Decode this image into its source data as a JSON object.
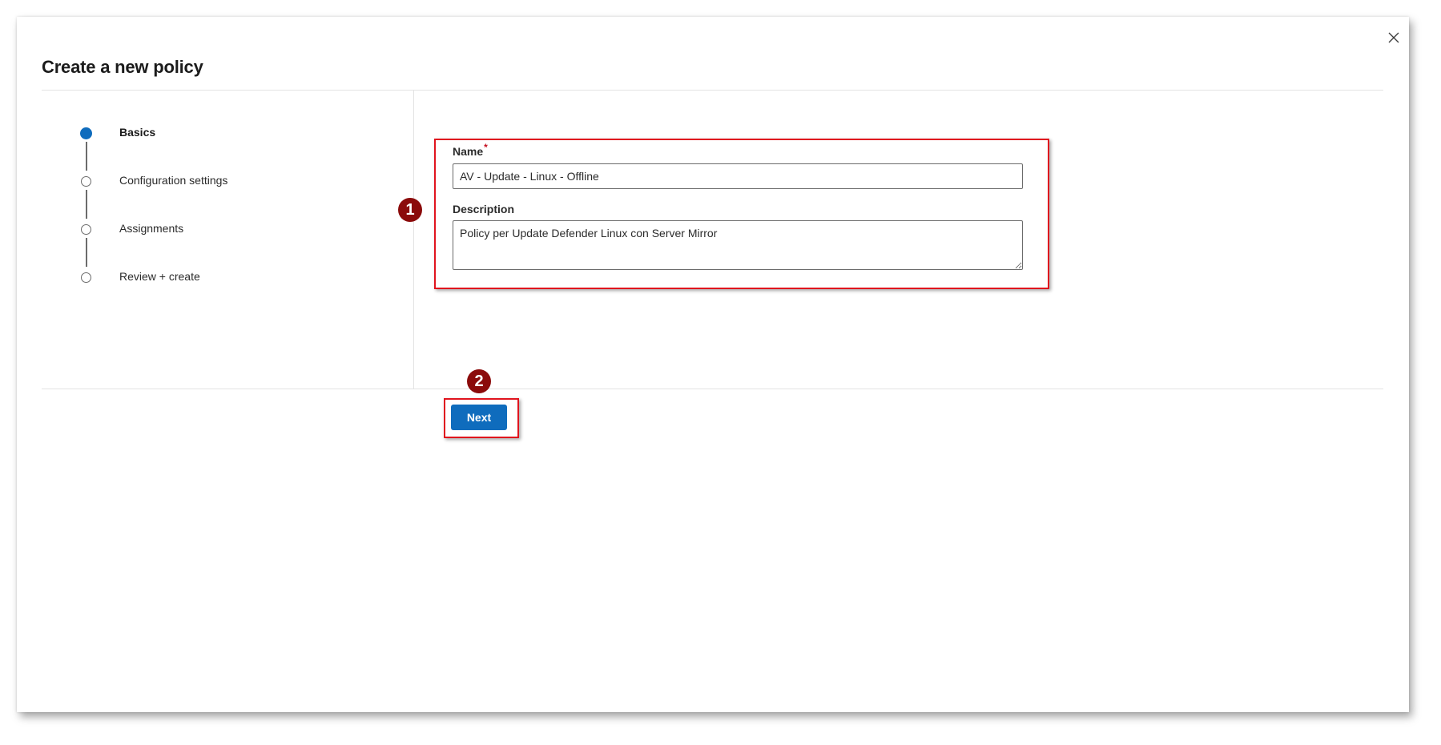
{
  "dialog": {
    "title": "Create a new policy",
    "close_label": "×"
  },
  "steps": [
    {
      "label": "Basics",
      "state": "active"
    },
    {
      "label": "Configuration settings",
      "state": "pending"
    },
    {
      "label": "Assignments",
      "state": "pending"
    },
    {
      "label": "Review + create",
      "state": "pending"
    }
  ],
  "form": {
    "name_label": "Name",
    "name_required_mark": "*",
    "name_value": "AV - Update - Linux - Offline",
    "description_label": "Description",
    "description_value": "Policy per Update Defender Linux con Server Mirror"
  },
  "annotations": {
    "marker_1": "1",
    "marker_2": "2",
    "highlight_color": "#e0141e",
    "marker_color": "#8b0b0b"
  },
  "footer": {
    "next_label": "Next"
  },
  "colors": {
    "accent": "#0f6cbd"
  }
}
